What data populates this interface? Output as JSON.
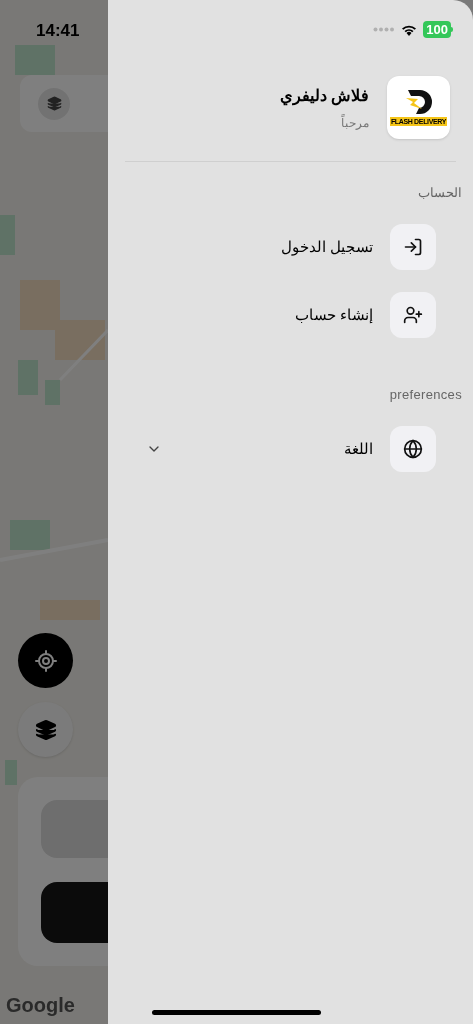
{
  "status_bar": {
    "time": "14:41",
    "battery": "100"
  },
  "map": {
    "attribution": "Google"
  },
  "drawer": {
    "logo_text": "FLASH DELIVERY",
    "app_name": "فلاش دليفري",
    "greeting": "مرحباً",
    "sections": [
      {
        "title": "الحساب",
        "items": [
          {
            "label": "تسجيل الدخول",
            "kind": "login",
            "expandable": false
          },
          {
            "label": "إنشاء حساب",
            "kind": "signup",
            "expandable": false
          }
        ]
      },
      {
        "title": "preferences",
        "items": [
          {
            "label": "اللغة",
            "kind": "language",
            "expandable": true
          }
        ]
      }
    ]
  }
}
